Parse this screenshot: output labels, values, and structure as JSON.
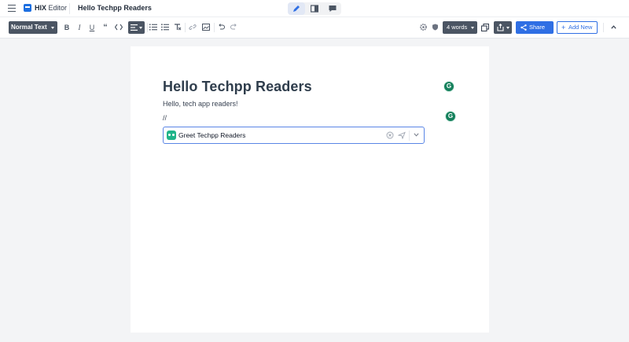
{
  "app": {
    "brand_name": "HIX",
    "brand_suffix": "Editor",
    "document_title": "Hello Techpp Readers"
  },
  "topbar": {
    "modes": [
      {
        "icon": "pen-icon",
        "active": true
      },
      {
        "icon": "split-view-icon",
        "active": false
      },
      {
        "icon": "chat-icon",
        "active": false
      }
    ]
  },
  "toolbar": {
    "text_style": "Normal Text",
    "word_count": "4 words",
    "share_label": "Share",
    "add_new_label": "Add New"
  },
  "document": {
    "heading": "Hello Techpp Readers",
    "paragraph": "Hello, tech app readers!",
    "command_line": "//"
  },
  "ai_prompt": {
    "value": "Greet Techpp Readers",
    "placeholder": ""
  },
  "colors": {
    "accent": "#2f6fe4",
    "toolbar_dark": "#4b5563",
    "grammarly": "#15805c",
    "ai_brand": "#20b48a"
  }
}
